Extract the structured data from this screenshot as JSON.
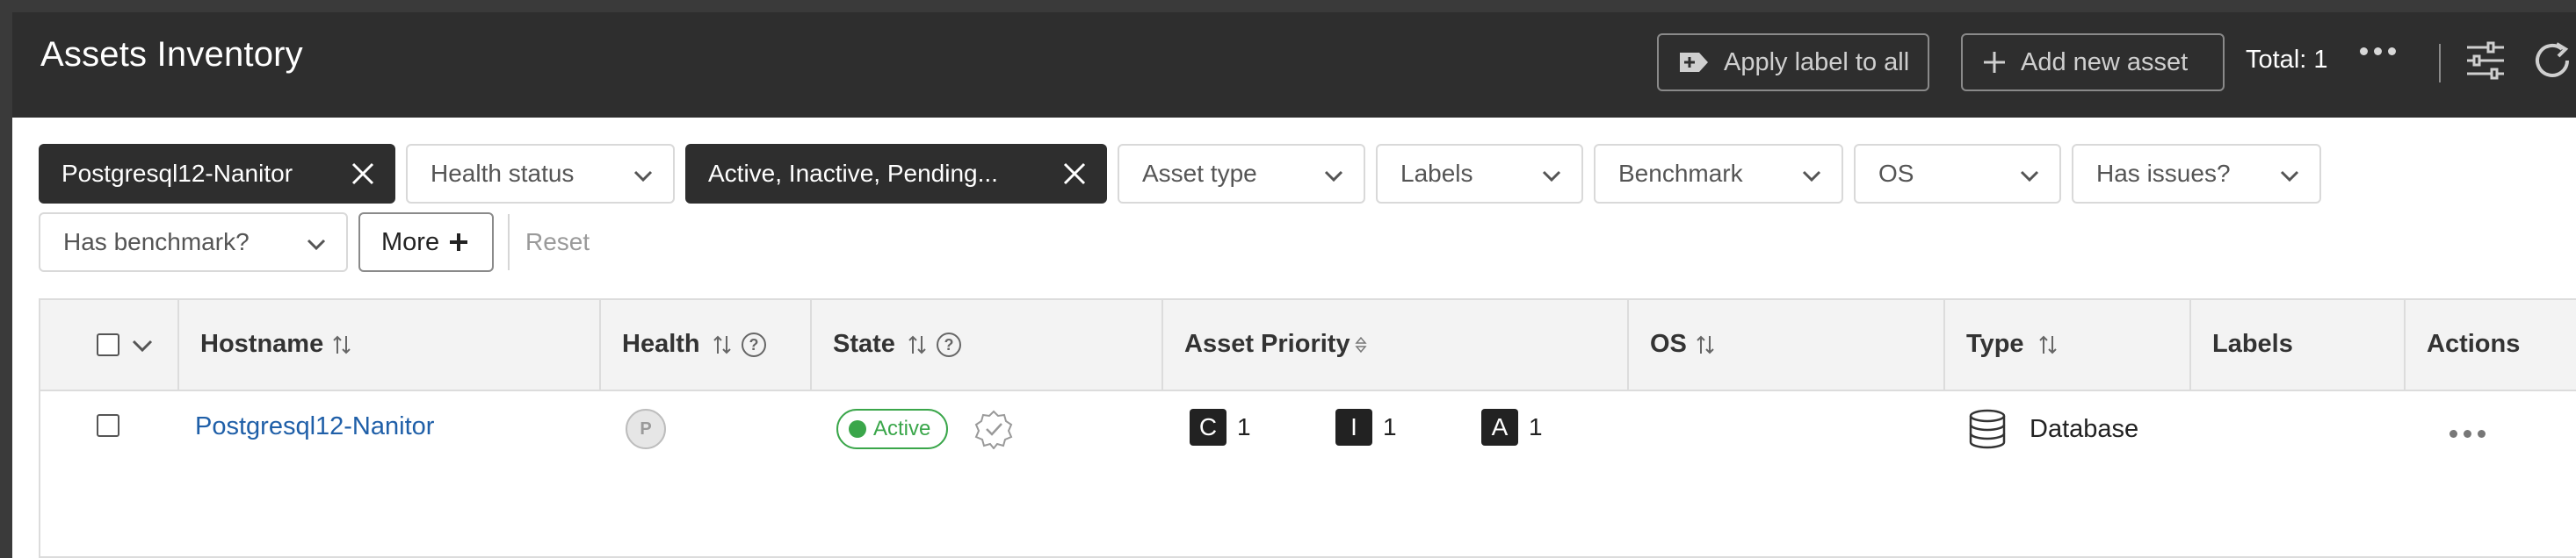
{
  "header": {
    "title": "Assets Inventory",
    "apply_label": "Apply label to all",
    "add_asset": "Add new asset",
    "total": "Total: 1"
  },
  "filters": {
    "chips": [
      {
        "label": "Postgresql12-Nanitor",
        "active": true
      },
      {
        "label": "Health status",
        "active": false
      },
      {
        "label": "Active, Inactive, Pending...",
        "active": true
      },
      {
        "label": "Asset type",
        "active": false
      },
      {
        "label": "Labels",
        "active": false
      },
      {
        "label": "Benchmark",
        "active": false
      },
      {
        "label": "OS",
        "active": false
      },
      {
        "label": "Has issues?",
        "active": false
      },
      {
        "label": "Has benchmark?",
        "active": false
      }
    ],
    "more_label": "More",
    "reset_label": "Reset"
  },
  "table": {
    "columns": [
      "Hostname",
      "Health",
      "State",
      "Asset Priority",
      "OS",
      "Type",
      "Labels",
      "Actions"
    ],
    "rows": [
      {
        "hostname": "Postgresql12-Nanitor",
        "health": "P",
        "state": "Active",
        "priority": [
          {
            "key": "C",
            "value": "1"
          },
          {
            "key": "I",
            "value": "1"
          },
          {
            "key": "A",
            "value": "1"
          }
        ],
        "os": "",
        "type": "Database",
        "labels": ""
      }
    ]
  },
  "colors": {
    "topbar_bg": "#2e2e2e",
    "link": "#1f5fa8",
    "active_green": "#3aa64a",
    "chip_dark": "#2e2e2e"
  }
}
